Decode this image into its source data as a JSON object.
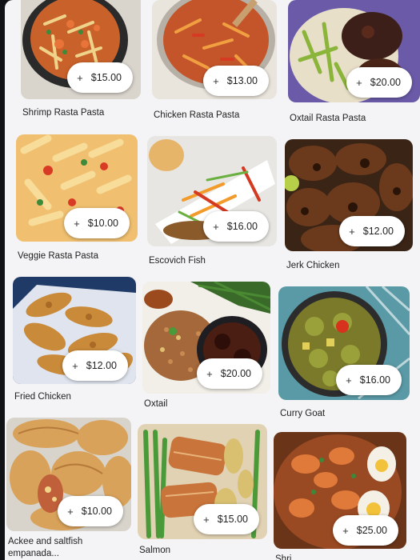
{
  "menu": {
    "items": [
      {
        "name": "Shrimp Rasta Pasta",
        "price": "$15.00",
        "add_icon": "+"
      },
      {
        "name": "Chicken Rasta Pasta",
        "price": "$13.00",
        "add_icon": "+"
      },
      {
        "name": "Oxtail Rasta Pasta",
        "price": "$20.00",
        "add_icon": "+"
      },
      {
        "name": "Veggie Rasta Pasta",
        "price": "$10.00",
        "add_icon": "+"
      },
      {
        "name": "Escovich Fish",
        "price": "$16.00",
        "add_icon": "+"
      },
      {
        "name": "Jerk Chicken",
        "price": "$12.00",
        "add_icon": "+"
      },
      {
        "name": "Fried Chicken",
        "price": "$12.00",
        "add_icon": "+"
      },
      {
        "name": "Oxtail",
        "price": "$20.00",
        "add_icon": "+"
      },
      {
        "name": "Curry Goat",
        "price": "$16.00",
        "add_icon": "+"
      },
      {
        "name": "Ackee and saltfish empanada...",
        "price": "$10.00",
        "add_icon": "+"
      },
      {
        "name": "Salmon",
        "price": "$15.00",
        "add_icon": "+"
      },
      {
        "name": "Shri...",
        "price": "$25.00",
        "add_icon": "+"
      }
    ]
  }
}
